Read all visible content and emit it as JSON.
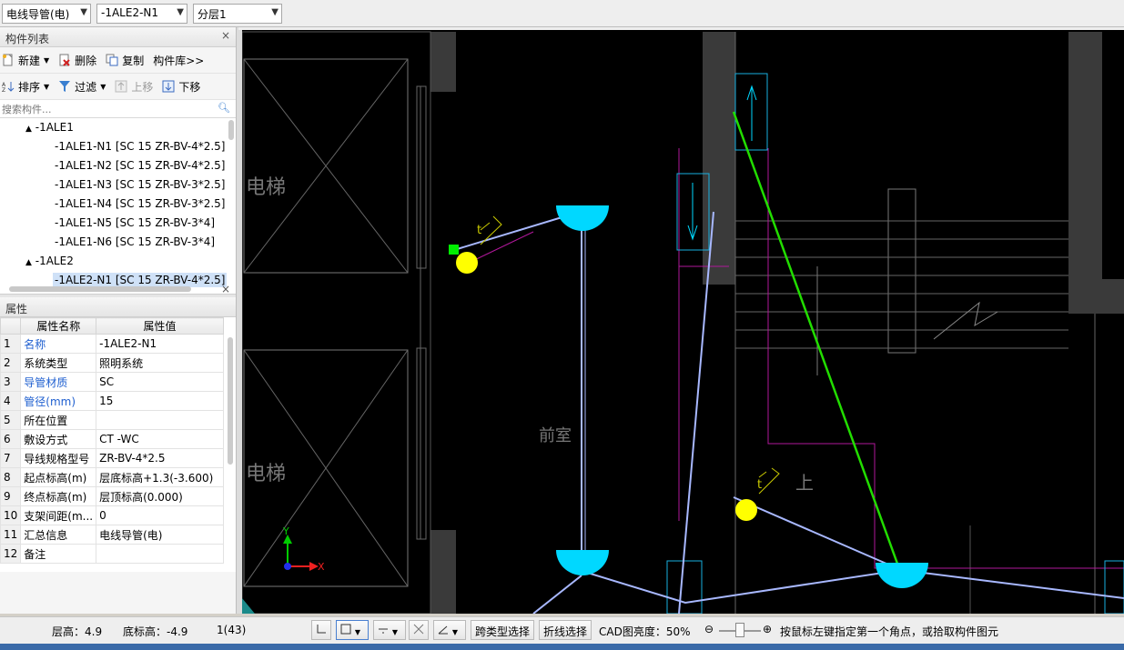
{
  "toolbar": {
    "component_type": "电线导管(电)",
    "component_name": "-1ALE2-N1",
    "layer": "分层1"
  },
  "component_list": {
    "title": "构件列表",
    "buttons": {
      "new": "新建",
      "delete": "删除",
      "copy": "复制",
      "library": "构件库>>",
      "sort": "排序",
      "filter": "过滤",
      "move_up": "上移",
      "move_down": "下移"
    },
    "search_placeholder": "搜索构件...",
    "tree": [
      {
        "label": "-1ALE1",
        "level": 0
      },
      {
        "label": "-1ALE1-N1 [SC 15 ZR-BV-4*2.5]",
        "level": 1
      },
      {
        "label": "-1ALE1-N2 [SC 15 ZR-BV-4*2.5]",
        "level": 1
      },
      {
        "label": "-1ALE1-N3 [SC 15 ZR-BV-3*2.5]",
        "level": 1
      },
      {
        "label": "-1ALE1-N4 [SC 15 ZR-BV-3*2.5]",
        "level": 1
      },
      {
        "label": "-1ALE1-N5 [SC 15 ZR-BV-3*4]",
        "level": 1
      },
      {
        "label": "-1ALE1-N6 [SC 15 ZR-BV-3*4]",
        "level": 1
      },
      {
        "label": "-1ALE2",
        "level": 0
      },
      {
        "label": "-1ALE2-N1 [SC 15 ZR-BV-4*2.5]",
        "level": 1
      }
    ]
  },
  "properties": {
    "title": "属性",
    "col_name": "属性名称",
    "col_value": "属性值",
    "rows": [
      {
        "num": "1",
        "name": "名称",
        "value": "-1ALE2-N1",
        "blue": true
      },
      {
        "num": "2",
        "name": "系统类型",
        "value": "照明系统",
        "blue": false
      },
      {
        "num": "3",
        "name": "导管材质",
        "value": "SC",
        "blue": true
      },
      {
        "num": "4",
        "name": "管径(mm)",
        "value": "15",
        "blue": true
      },
      {
        "num": "5",
        "name": "所在位置",
        "value": "",
        "blue": false
      },
      {
        "num": "6",
        "name": "敷设方式",
        "value": "CT -WC",
        "blue": false
      },
      {
        "num": "7",
        "name": "导线规格型号",
        "value": "ZR-BV-4*2.5",
        "blue": false
      },
      {
        "num": "8",
        "name": "起点标高(m)",
        "value": "层底标高+1.3(-3.600)",
        "blue": false
      },
      {
        "num": "9",
        "name": "终点标高(m)",
        "value": "层顶标高(0.000)",
        "blue": false
      },
      {
        "num": "10",
        "name": "支架间距(m...",
        "value": "0",
        "blue": false
      },
      {
        "num": "11",
        "name": "汇总信息",
        "value": "电线导管(电)",
        "blue": false
      },
      {
        "num": "12",
        "name": "备注",
        "value": "",
        "blue": false
      }
    ]
  },
  "canvas": {
    "labels": {
      "elevator1": "电梯",
      "elevator2": "电梯",
      "vestibule": "前室",
      "up": "上",
      "axis_y": "Y",
      "axis_x": "X"
    },
    "colors": {
      "background": "#000000",
      "lamp": "#00d8ff",
      "switch": "#ffff00",
      "conduit": "#a8b8ff",
      "wall": "#3a3a3a",
      "green_line": "#22dd00",
      "magenta": "#c020a0"
    }
  },
  "statusbar": {
    "floor_height": "层高：4.9",
    "bottom_elevation": "底标高：-4.9",
    "page": "1(43)",
    "cross_type_select": "跨类型选择",
    "polyline_select": "折线选择",
    "cad_brightness": "CAD图亮度：50%",
    "hint": "按鼠标左键指定第一个角点，或拾取构件图元"
  }
}
